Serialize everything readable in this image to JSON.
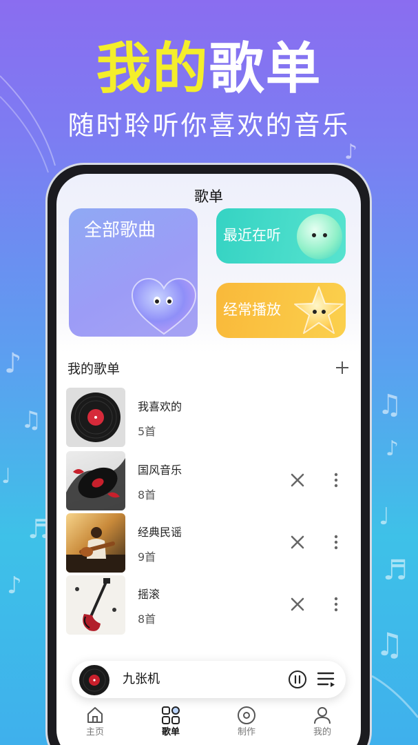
{
  "promo": {
    "title_part1": "我的",
    "title_part2": "歌单",
    "subtitle": "随时聆听你喜欢的音乐"
  },
  "screen": {
    "title": "歌单"
  },
  "cards": {
    "all_songs": "全部歌曲",
    "recent": "最近在听",
    "frequent": "经常播放"
  },
  "my_playlists": {
    "section_title": "我的歌单",
    "add_icon": "plus-icon",
    "items": [
      {
        "name": "我喜欢的",
        "count": "5首",
        "cover": "vinyl-record",
        "deletable": false
      },
      {
        "name": "国风音乐",
        "count": "8首",
        "cover": "ink-vinyl-art",
        "deletable": true
      },
      {
        "name": "经典民谣",
        "count": "9首",
        "cover": "guitarist-photo",
        "deletable": true
      },
      {
        "name": "摇滚",
        "count": "8首",
        "cover": "punk-guitar-art",
        "deletable": true
      }
    ]
  },
  "mini_player": {
    "title": "九张机",
    "play_state_icon": "pause-icon",
    "queue_icon": "playlist-queue-icon"
  },
  "tabbar": {
    "items": [
      {
        "label": "主页",
        "icon": "home-icon",
        "active": false
      },
      {
        "label": "歌单",
        "icon": "grid-icon",
        "active": true
      },
      {
        "label": "制作",
        "icon": "disc-icon",
        "active": false
      },
      {
        "label": "我的",
        "icon": "user-icon",
        "active": false
      }
    ]
  },
  "colors": {
    "title_accent": "#f4ee2b",
    "card_all": "#9c9cf6",
    "card_recent": "#45dcc9",
    "card_frequent": "#fac443"
  }
}
